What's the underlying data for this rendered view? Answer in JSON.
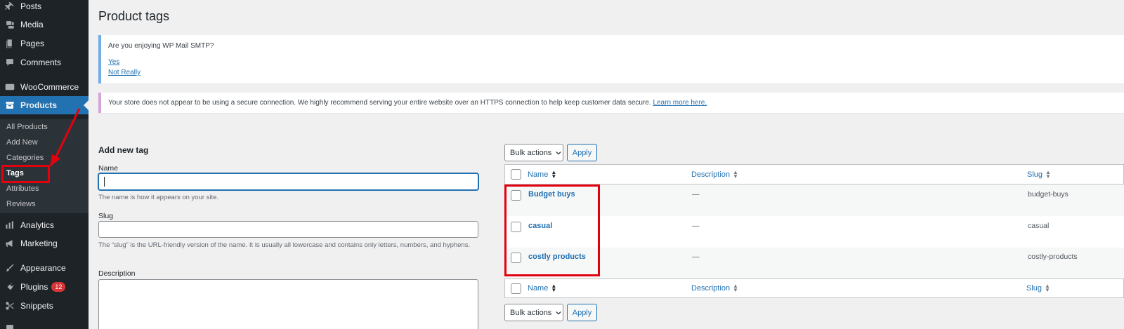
{
  "sidebar": {
    "items": [
      {
        "label": "Posts",
        "icon": "pin-icon"
      },
      {
        "label": "Media",
        "icon": "media-icon"
      },
      {
        "label": "Pages",
        "icon": "pages-icon"
      },
      {
        "label": "Comments",
        "icon": "comment-icon"
      },
      {
        "label": "WooCommerce",
        "icon": "woocommerce-icon"
      },
      {
        "label": "Products",
        "icon": "archive-icon"
      },
      {
        "label": "Analytics",
        "icon": "chart-bar-icon"
      },
      {
        "label": "Marketing",
        "icon": "megaphone-icon"
      },
      {
        "label": "Appearance",
        "icon": "paintbrush-icon"
      },
      {
        "label": "Plugins",
        "icon": "plugin-icon"
      },
      {
        "label": "Snippets",
        "icon": "scissors-icon"
      }
    ],
    "plugins_badge": "12",
    "submenu": [
      "All Products",
      "Add New",
      "Categories",
      "Tags",
      "Attributes",
      "Reviews"
    ]
  },
  "page_title": "Product tags",
  "smtp_notice": {
    "question": "Are you enjoying WP Mail SMTP?",
    "yes": "Yes",
    "no": "Not Really"
  },
  "ssl_notice": {
    "text": "Your store does not appear to be using a secure connection. We highly recommend serving your entire website over an HTTPS connection to help keep customer data secure.",
    "link": "Learn more here."
  },
  "form": {
    "heading": "Add new tag",
    "name_label": "Name",
    "name_help": "The name is how it appears on your site.",
    "slug_label": "Slug",
    "slug_help": "The “slug” is the URL-friendly version of the name. It is usually all lowercase and contains only letters, numbers, and hyphens.",
    "description_label": "Description"
  },
  "bulk": {
    "label": "Bulk actions",
    "apply": "Apply"
  },
  "table": {
    "columns": {
      "name": "Name",
      "description": "Description",
      "slug": "Slug"
    },
    "rows": [
      {
        "name": "Budget buys",
        "description": "—",
        "slug": "budget-buys"
      },
      {
        "name": "casual",
        "description": "—",
        "slug": "casual"
      },
      {
        "name": "costly products",
        "description": "—",
        "slug": "costly-products"
      }
    ]
  },
  "colors": {
    "sidebar": "#1d2327",
    "active": "#2271b1",
    "highlight": "#e3000f",
    "link": "#2271b1"
  }
}
